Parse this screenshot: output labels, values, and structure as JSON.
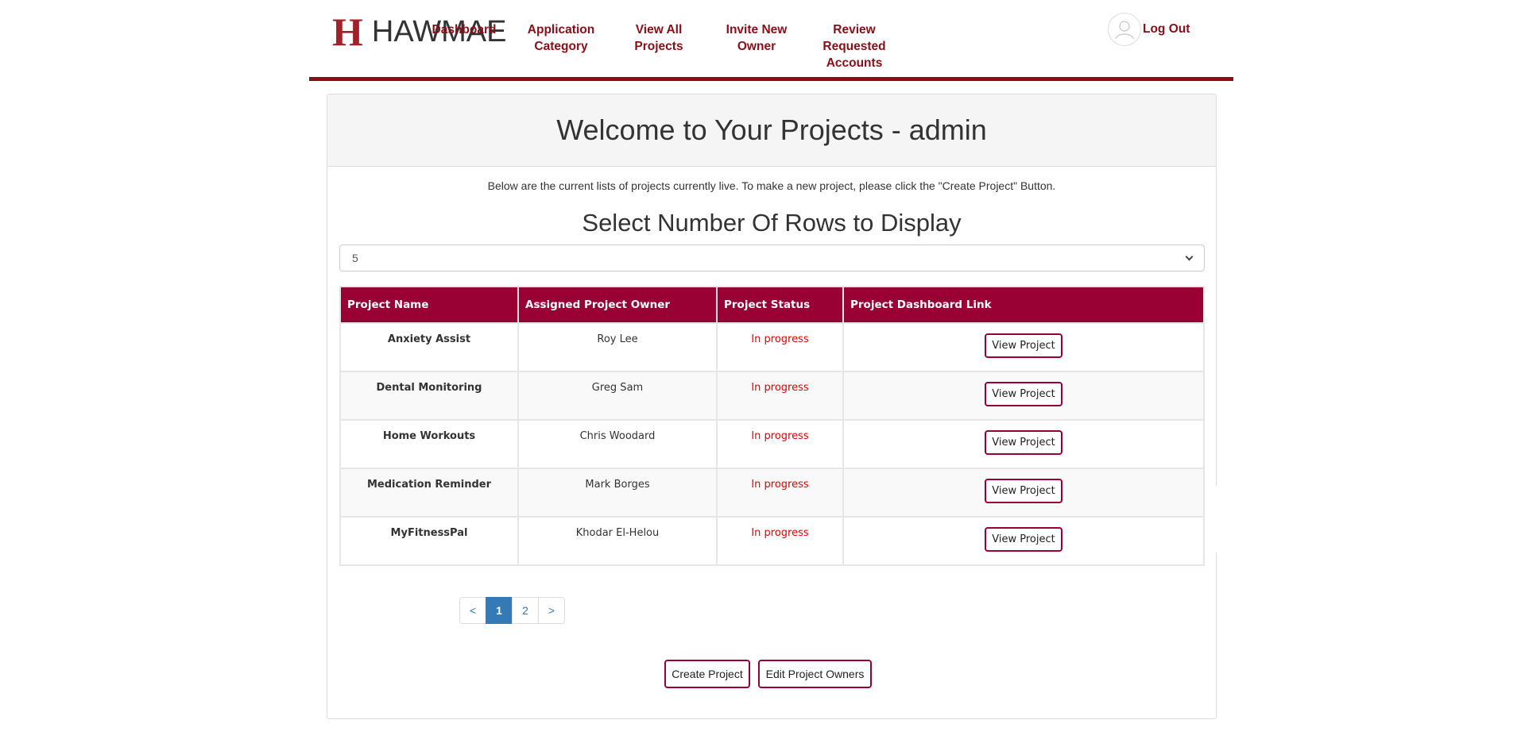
{
  "brand": {
    "mark": "H",
    "name": "HAWMAE",
    "color": "#a31f2a"
  },
  "nav": {
    "dashboard": "Dashboard",
    "application_category": "Application Category",
    "view_all_projects": "View All Projects",
    "invite_new_owner": "Invite New Owner",
    "review_requested_accounts": "Review Requested Accounts",
    "logout": "Log Out"
  },
  "panel": {
    "title": "Welcome to Your Projects - admin",
    "intro": "Below are the current lists of projects currently live. To make a new project, please click the \"Create Project\" Button.",
    "rows_title": "Select Number Of Rows to Display",
    "rows_selected": "5"
  },
  "table": {
    "headers": [
      "Project Name",
      "Assigned Project Owner",
      "Project Status",
      "Project Dashboard Link"
    ],
    "rows": [
      {
        "name": "Anxiety Assist",
        "owner": "Roy Lee",
        "status": "In progress",
        "link": "View Project"
      },
      {
        "name": "Dental Monitoring",
        "owner": "Greg Sam",
        "status": "In progress",
        "link": "View Project"
      },
      {
        "name": "Home Workouts",
        "owner": "Chris Woodard",
        "status": "In progress",
        "link": "View Project"
      },
      {
        "name": "Medication Reminder",
        "owner": "Mark Borges",
        "status": "In progress",
        "link": "View Project"
      },
      {
        "name": "MyFitnessPal",
        "owner": "Khodar El-Helou",
        "status": "In progress",
        "link": "View Project"
      }
    ]
  },
  "pagination": {
    "prev": "<",
    "pages": [
      "1",
      "2"
    ],
    "active": "1",
    "next": ">"
  },
  "actions": {
    "create_project": "Create Project",
    "edit_project_owners": "Edit Project Owners"
  },
  "colors": {
    "header_border": "#8b0d17",
    "table_header": "#990033",
    "status": "#e60000",
    "page_active": "#337ab7"
  }
}
